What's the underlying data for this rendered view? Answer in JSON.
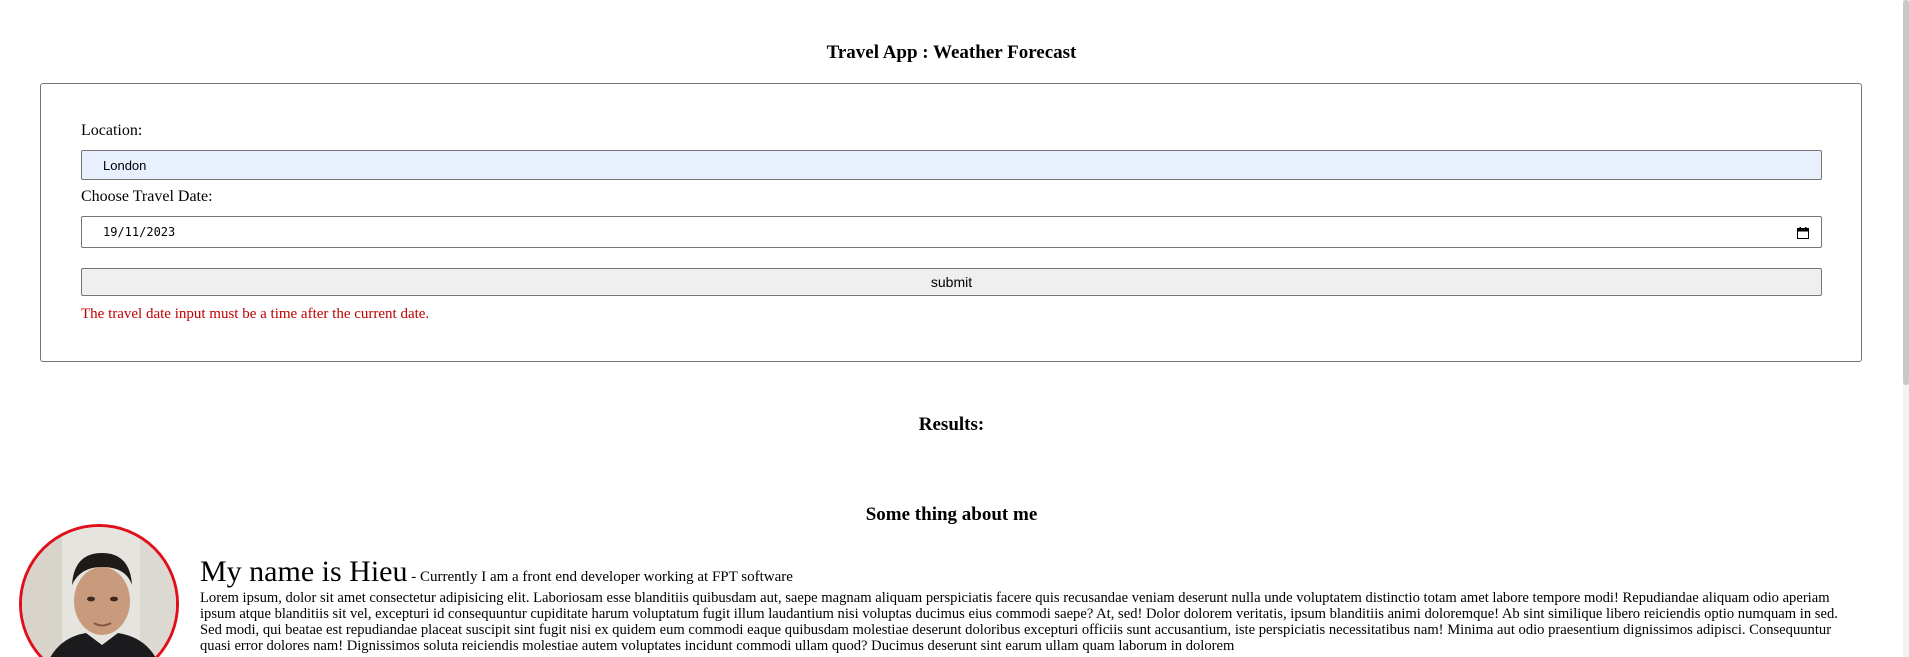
{
  "header": {
    "title": "Travel App : Weather Forecast"
  },
  "form": {
    "location_label": "Location:",
    "location_value": "London",
    "date_label": "Choose Travel Date:",
    "date_value": "19/11/2023",
    "submit_label": "submit",
    "error_message": "The travel date input must be a time after the current date."
  },
  "results": {
    "heading": "Results:"
  },
  "about": {
    "heading": "Some thing about me",
    "name": "My name is Hieu",
    "tagline": " - Currently I am a front end developer working at FPT software",
    "body": "Lorem ipsum, dolor sit amet consectetur adipisicing elit. Laboriosam esse blanditiis quibusdam aut, saepe magnam aliquam perspiciatis facere quis recusandae veniam deserunt nulla unde voluptatem distinctio totam amet labore tempore modi! Repudiandae aliquam odio aperiam ipsum atque blanditiis sit vel, excepturi id consequuntur cupiditate harum voluptatum fugit illum laudantium nisi voluptas ducimus eius commodi saepe? At, sed! Dolor dolorem veritatis, ipsum blanditiis animi doloremque! Ab sint similique libero reiciendis optio numquam in sed. Sed modi, qui beatae est repudiandae placeat suscipit sint fugit nisi ex quidem eum commodi eaque quibusdam molestiae deserunt doloribus excepturi officiis sunt accusantium, iste perspiciatis necessitatibus nam! Minima aut odio praesentium dignissimos adipisci. Consequuntur quasi error dolores nam! Dignissimos soluta reiciendis molestiae autem voluptates incidunt commodi ullam quod? Ducimus deserunt sint earum ullam quam laborum in dolorem"
  },
  "icons": {
    "calendar": "calendar-icon",
    "avatar": "profile-photo"
  },
  "colors": {
    "error": "#c00000",
    "avatar_border": "#e0101a",
    "autofill_bg": "#e8f0fe"
  }
}
